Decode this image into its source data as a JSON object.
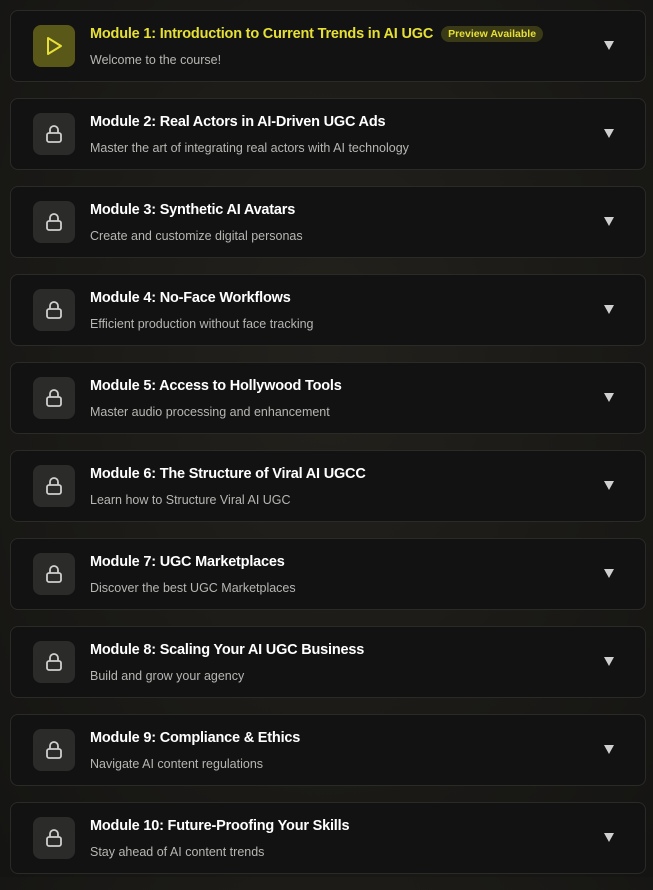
{
  "colors": {
    "background": "#1b1a17",
    "card": "#121212",
    "accent": "#e6e036",
    "active_icon_bg": "#5a5818",
    "locked_icon_bg": "#2b2b2a",
    "subtitle": "#b6b6b2"
  },
  "modules": [
    {
      "title": "Module 1: Introduction to Current Trends in AI UGC",
      "subtitle": "Welcome to the course!",
      "badge": "Preview Available",
      "icon": "play-icon",
      "state": "active"
    },
    {
      "title": "Module 2: Real Actors in AI-Driven UGC Ads",
      "subtitle": "Master the art of integrating real actors with AI technology",
      "icon": "lock-icon",
      "state": "locked"
    },
    {
      "title": "Module 3: Synthetic AI Avatars",
      "subtitle": "Create and customize digital personas",
      "icon": "lock-icon",
      "state": "locked"
    },
    {
      "title": "Module 4: No-Face Workflows",
      "subtitle": "Efficient production without face tracking",
      "icon": "lock-icon",
      "state": "locked"
    },
    {
      "title": "Module 5: Access to Hollywood Tools",
      "subtitle": "Master audio processing and enhancement",
      "icon": "lock-icon",
      "state": "locked"
    },
    {
      "title": "Module 6: The Structure of Viral AI UGCC",
      "subtitle": "Learn how to Structure Viral AI UGC",
      "icon": "lock-icon",
      "state": "locked"
    },
    {
      "title": "Module 7: UGC Marketplaces",
      "subtitle": "Discover the best UGC Marketplaces",
      "icon": "lock-icon",
      "state": "locked"
    },
    {
      "title": "Module 8: Scaling Your AI UGC Business",
      "subtitle": "Build and grow your agency",
      "icon": "lock-icon",
      "state": "locked"
    },
    {
      "title": "Module 9: Compliance & Ethics",
      "subtitle": "Navigate AI content regulations",
      "icon": "lock-icon",
      "state": "locked"
    },
    {
      "title": "Module 10: Future-Proofing Your Skills",
      "subtitle": "Stay ahead of AI content trends",
      "icon": "lock-icon",
      "state": "locked"
    }
  ]
}
